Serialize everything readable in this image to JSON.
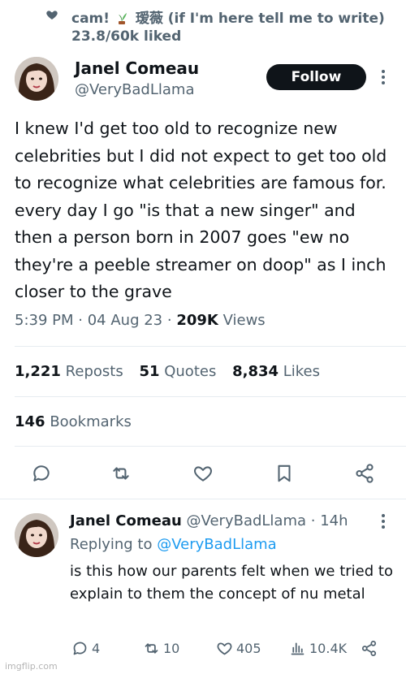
{
  "social_context": {
    "name": "cam!",
    "name_cjk": "瑷薇",
    "suffix": "(if I'm here tell me to write)",
    "liked": "23.8/60k liked"
  },
  "tweet": {
    "author_name": "Janel Comeau",
    "author_handle": "@VeryBadLlama",
    "follow_label": "Follow",
    "text": "I knew I'd get too old to recognize new celebrities but I did not expect to get too old to recognize what celebrities are famous for. every day I go \"is that a new singer\" and then a person born in 2007 goes \"ew no they're a peeble streamer on doop\" as I inch closer to the grave",
    "time": "5:39 PM",
    "date": "04 Aug 23",
    "views_count": "209K",
    "views_label": "Views",
    "reposts_count": "1,221",
    "reposts_label": "Reposts",
    "quotes_count": "51",
    "quotes_label": "Quotes",
    "likes_count": "8,834",
    "likes_label": "Likes",
    "bookmarks_count": "146",
    "bookmarks_label": "Bookmarks"
  },
  "reply": {
    "author_name": "Janel Comeau",
    "author_handle": "@VeryBadLlama",
    "age": "14h",
    "replying_prefix": "Replying to",
    "replying_handle": "@VeryBadLlama",
    "text": "is this how our parents felt when we tried to explain to them the concept of nu metal",
    "replies": "4",
    "reposts": "10",
    "likes": "405",
    "views": "10.4K"
  },
  "watermark": "imgflip.com",
  "icons": [
    "heart-icon",
    "plant-emoji-icon",
    "more-icon",
    "reply-icon",
    "repost-icon",
    "like-icon",
    "bookmark-icon",
    "share-icon",
    "views-icon"
  ],
  "colors": {
    "text": "#0f1419",
    "secondary": "#536471",
    "link": "#1d9bf0",
    "divider": "#e6ecf0",
    "follow_bg": "#0f1419"
  }
}
